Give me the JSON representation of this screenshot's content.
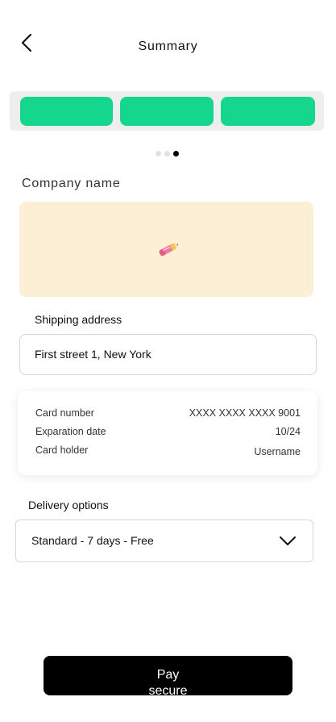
{
  "header": {
    "title": "Summary",
    "back_icon": "chevron-left-icon"
  },
  "stepper": {
    "steps": [
      {
        "complete": true
      },
      {
        "complete": true
      },
      {
        "complete": true
      }
    ],
    "active_color": "#14d68c",
    "track_color": "#eeeeee"
  },
  "pagination": {
    "pages": 3,
    "current": 3
  },
  "company": {
    "label": "Company name",
    "card_color": "#fcefd5",
    "icon": "pencil-eraser-icon"
  },
  "shipping": {
    "label": "Shipping address",
    "value": "First street 1, New York"
  },
  "payment": {
    "rows": [
      {
        "label": "Card number",
        "value": "XXXX XXXX XXXX 9001"
      },
      {
        "label": "Exparation date",
        "value": "10/24"
      },
      {
        "label": "Card holder",
        "value": "Username"
      }
    ]
  },
  "delivery": {
    "label": "Delivery options",
    "selected": "Standard - 7 days - Free",
    "icon": "chevron-down-icon"
  },
  "action": {
    "pay_label": "Pay secure"
  }
}
